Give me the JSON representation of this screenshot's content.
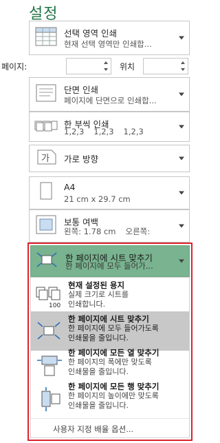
{
  "page_title": "설정",
  "print_area": {
    "title": "선택 영역 인쇄",
    "subtitle": "현재 선택 영역만 인쇄합..."
  },
  "pages": {
    "label": "페이지:",
    "from_value": "",
    "to_label": "위치",
    "to_value": ""
  },
  "sides": {
    "title": "단면 인쇄",
    "subtitle": "페이지에 단면으로 인쇄합..."
  },
  "collation": {
    "title": "한 부씩 인쇄",
    "seq": [
      "1,2,3",
      "1,2,3",
      "1,2,3"
    ]
  },
  "orientation": {
    "title": "가로 방향",
    "icon_glyph": "가"
  },
  "paper": {
    "title": "A4",
    "subtitle": "21 cm x 29.7 cm"
  },
  "margins": {
    "title": "보통 여백",
    "left": "왼쪽:  1.78 cm",
    "right": "오른쪽:"
  },
  "scaling": {
    "title": "한 페이지에 시트 맞추기",
    "subtitle": "한 페이지에 모두 들어가..."
  },
  "scaling_menu": {
    "items": [
      {
        "title": "현재 설정된 용지",
        "line1": "실제 크기로 시트를",
        "line2": "인쇄합니다.",
        "icon": "actual-size-icon",
        "icon_text": "100"
      },
      {
        "title": "한 페이지에 시트 맞추기",
        "line1": "한 페이지에 모두 들어가도록",
        "line2": "인쇄물을 줄입니다.",
        "icon": "fit-sheet-icon"
      },
      {
        "title": "한 페이지에 모든 열 맞추기",
        "line1": "한 페이지의 폭에만 맞도록",
        "line2": "인쇄물을 줄입니다.",
        "icon": "fit-columns-icon"
      },
      {
        "title": "한 페이지에 모든 행 맞추기",
        "line1": "한 페이지의 높이에만 맞도록",
        "line2": "인쇄물을 줄입니다.",
        "icon": "fit-rows-icon"
      }
    ],
    "selected_index": 1,
    "custom_options": "사용자 지정 배율 옵션..."
  },
  "colors": {
    "accent": "#217346",
    "active_bg": "#79b38f",
    "highlight_border": "#e0202a",
    "selected_item_bg": "#c8c8c8"
  }
}
